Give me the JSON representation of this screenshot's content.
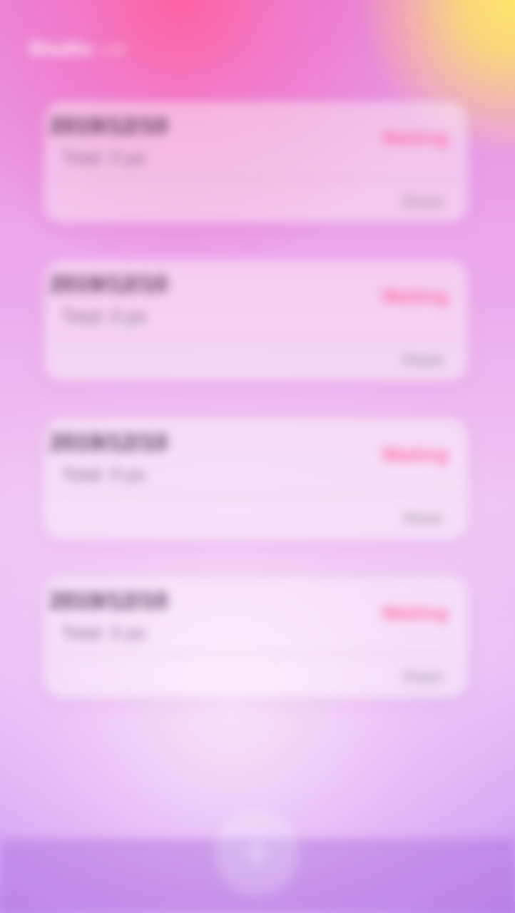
{
  "header": {
    "title": "Studio",
    "subtitle": "List"
  },
  "cards": [
    {
      "date": "2019/12/10",
      "meta": "Total: 0 ps",
      "status": "Waiting",
      "action": "Share"
    },
    {
      "date": "2019/12/10",
      "meta": "Total: 0 ps",
      "status": "Waiting",
      "action": "Share"
    },
    {
      "date": "2019/12/10",
      "meta": "Total: 0 ps",
      "status": "Waiting",
      "action": "Share"
    },
    {
      "date": "2019/12/10",
      "meta": "Total: 0 ps",
      "status": "Waiting",
      "action": "Share"
    }
  ],
  "colors": {
    "status": "#ff6aa0",
    "accent_top_right": "#ffe36a",
    "background_bottom": "#bb86f1"
  },
  "icons": {
    "fab": "plus-icon"
  }
}
